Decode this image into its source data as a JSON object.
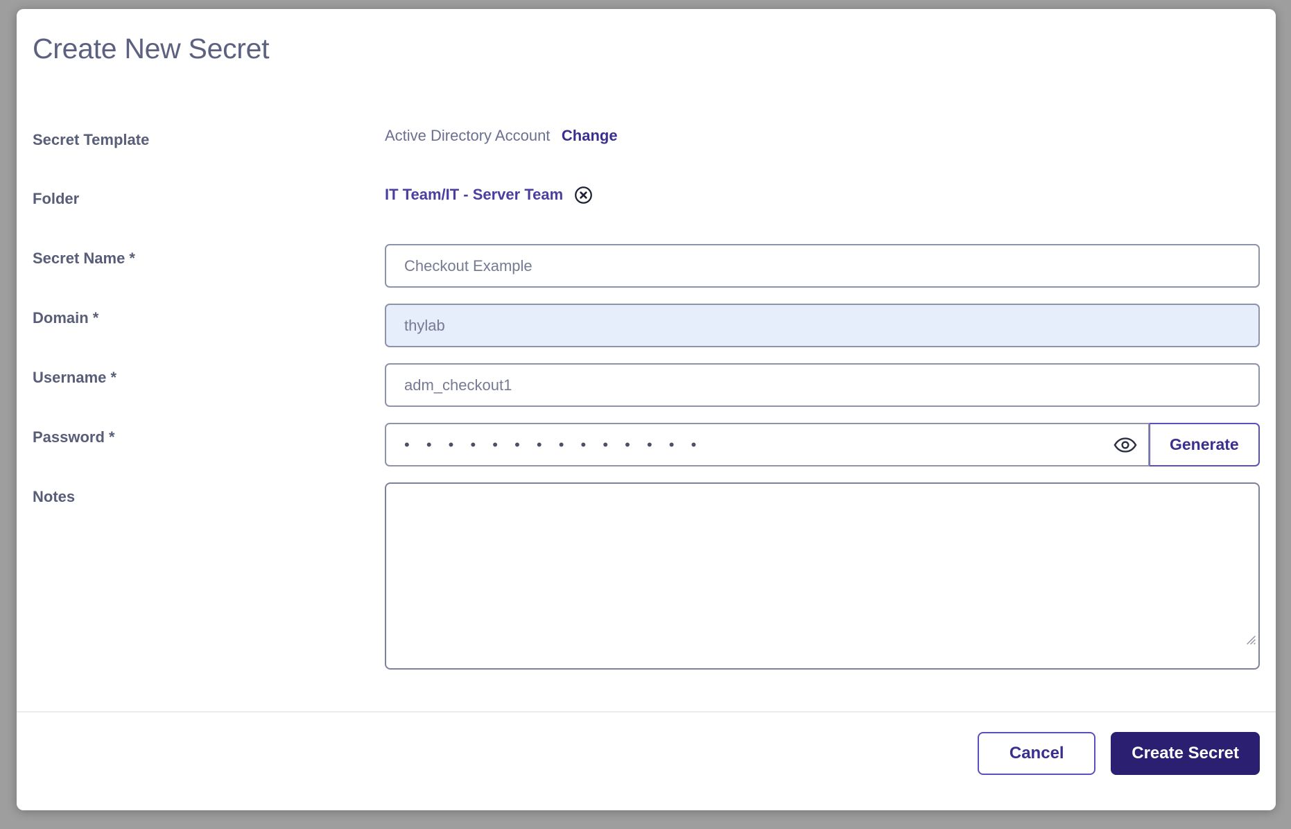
{
  "modal": {
    "title": "Create New Secret",
    "fields": {
      "secret_template": {
        "label": "Secret Template",
        "value": "Active Directory Account",
        "change_label": "Change"
      },
      "folder": {
        "label": "Folder",
        "value": "IT Team/IT - Server Team",
        "clear_icon": "circle-x-icon"
      },
      "secret_name": {
        "label": "Secret Name *",
        "value": "Checkout Example",
        "placeholder": "Checkout Example"
      },
      "domain": {
        "label": "Domain *",
        "value": "thylab",
        "placeholder": "thylab"
      },
      "username": {
        "label": "Username *",
        "value": "adm_checkout1",
        "placeholder": "adm_checkout1"
      },
      "password": {
        "label": "Password *",
        "masked_value": "• • • • • • • • • • • • • •",
        "reveal_icon": "eye-icon",
        "generate_label": "Generate"
      },
      "notes": {
        "label": "Notes",
        "value": "",
        "placeholder": ""
      }
    },
    "footer": {
      "cancel_label": "Cancel",
      "submit_label": "Create Secret"
    }
  },
  "colors": {
    "backdrop": "#9e9e9e",
    "surface": "#ffffff",
    "label_text": "#585d78",
    "muted_text": "#6c7090",
    "link_purple": "#3a2f91",
    "folder_purple": "#4a3fa0",
    "border_grey": "#8e92ab",
    "border_purple": "#5a4fbe",
    "autofill_blue": "#e6eefb",
    "primary_button": "#2b1f72",
    "divider": "#ececf1"
  }
}
